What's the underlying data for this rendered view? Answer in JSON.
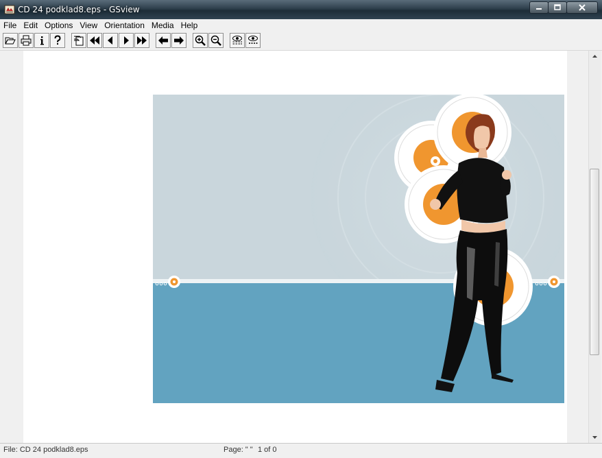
{
  "window": {
    "title": "CD 24 podklad8.eps - GSview",
    "app_icon": "gsview-app-icon"
  },
  "menu": {
    "items": [
      {
        "label": "File",
        "icon": ""
      },
      {
        "label": "Edit"
      },
      {
        "label": "Options"
      },
      {
        "label": "View"
      },
      {
        "label": "Orientation"
      },
      {
        "label": "Media"
      },
      {
        "label": "Help"
      }
    ]
  },
  "toolbar": {
    "buttons": [
      "open-icon",
      "print-icon",
      "info-icon",
      "help-icon",
      "goto-page-icon",
      "first-page-icon",
      "previous-page-icon",
      "next-page-icon",
      "last-page-icon",
      "back-icon",
      "forward-icon",
      "zoom-in-icon",
      "zoom-out-icon",
      "find-text-icon",
      "find-next-icon"
    ]
  },
  "status": {
    "file": "File: CD 24 podklad8.eps",
    "page": "Page: \" \"",
    "count": "1 of 0"
  },
  "colors": {
    "sky": "#c9d6dc",
    "water": "#62a3c0",
    "accent_orange": "#f0962f",
    "titlebar_dark": "#1d2d38"
  }
}
